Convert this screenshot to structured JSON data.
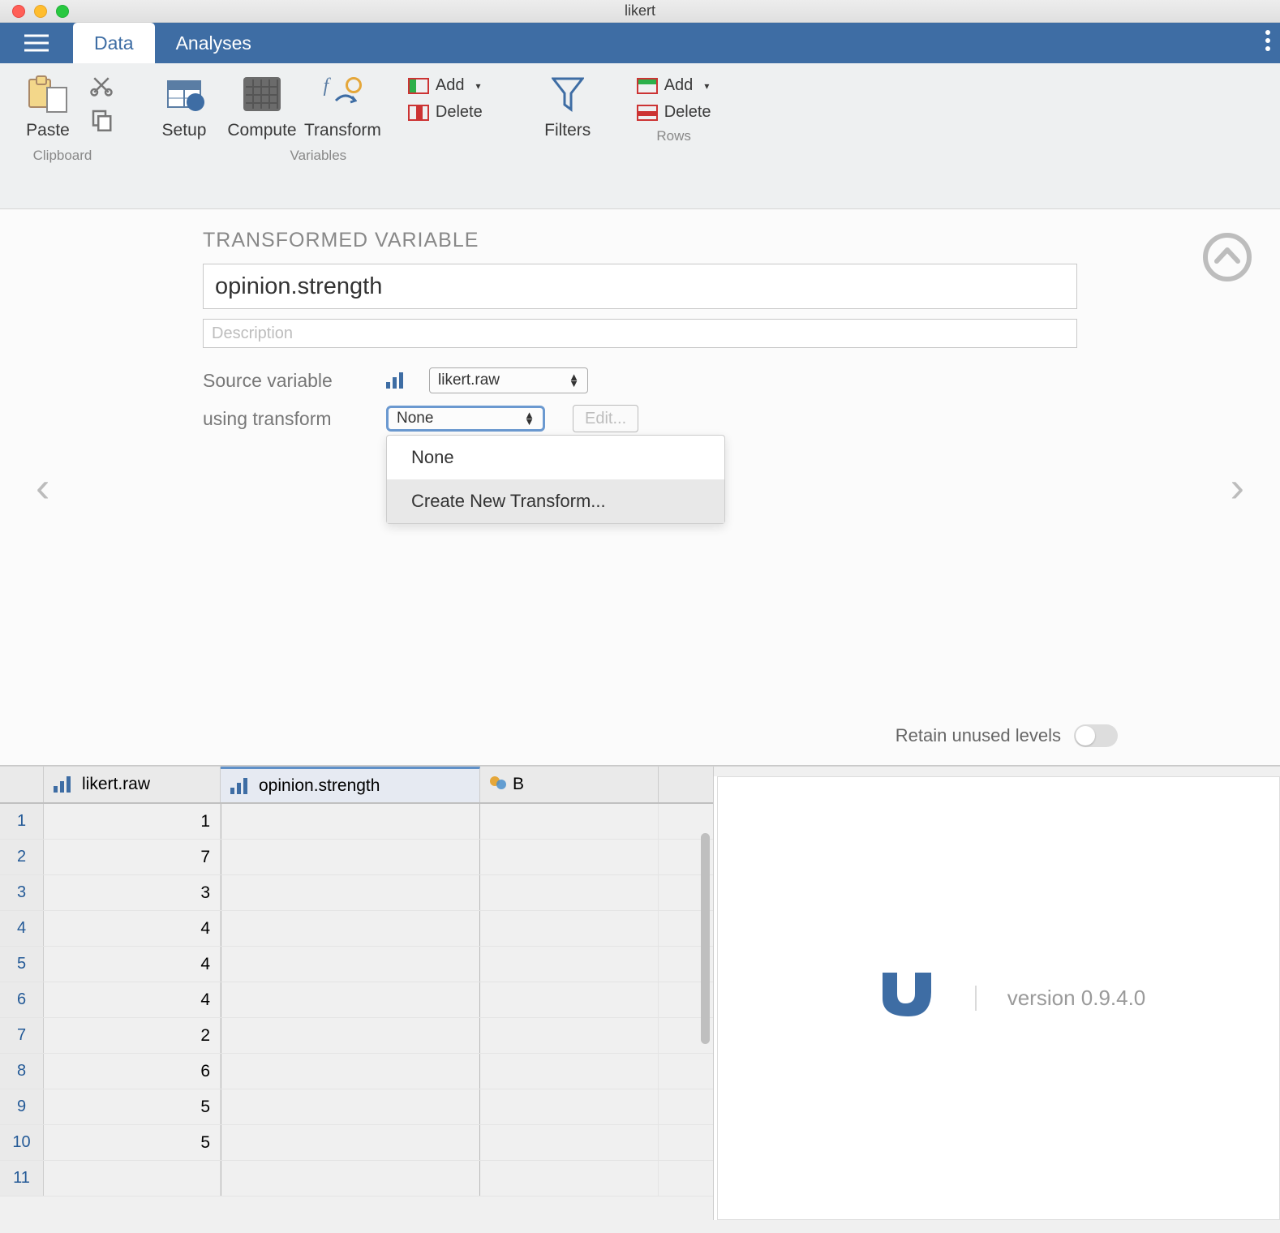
{
  "window": {
    "title": "likert"
  },
  "menu": {
    "tabs": {
      "data": "Data",
      "analyses": "Analyses"
    }
  },
  "toolbar": {
    "clipboard": {
      "paste": "Paste",
      "caption": "Clipboard"
    },
    "variables": {
      "setup": "Setup",
      "compute": "Compute",
      "transform": "Transform",
      "add": "Add",
      "delete": "Delete",
      "caption": "Variables"
    },
    "filters": "Filters",
    "rows": {
      "add": "Add",
      "delete": "Delete",
      "caption": "Rows"
    }
  },
  "editor": {
    "heading": "TRANSFORMED VARIABLE",
    "name": "opinion.strength",
    "desc_placeholder": "Description",
    "source_label": "Source variable",
    "source_value": "likert.raw",
    "transform_label": "using transform",
    "transform_value": "None",
    "edit_label": "Edit...",
    "dropdown_opts": {
      "none": "None",
      "create": "Create New Transform..."
    },
    "retain_label": "Retain unused levels",
    "retain_on": false
  },
  "sheet": {
    "columns": {
      "c1": "likert.raw",
      "c2": "opinion.strength",
      "c3": "B"
    },
    "rows": [
      {
        "n": "1",
        "c1": "1"
      },
      {
        "n": "2",
        "c1": "7"
      },
      {
        "n": "3",
        "c1": "3"
      },
      {
        "n": "4",
        "c1": "4"
      },
      {
        "n": "5",
        "c1": "4"
      },
      {
        "n": "6",
        "c1": "4"
      },
      {
        "n": "7",
        "c1": "2"
      },
      {
        "n": "8",
        "c1": "6"
      },
      {
        "n": "9",
        "c1": "5"
      },
      {
        "n": "10",
        "c1": "5"
      },
      {
        "n": "11",
        "c1": ""
      }
    ]
  },
  "results": {
    "version_text": "version 0.9.4.0"
  }
}
